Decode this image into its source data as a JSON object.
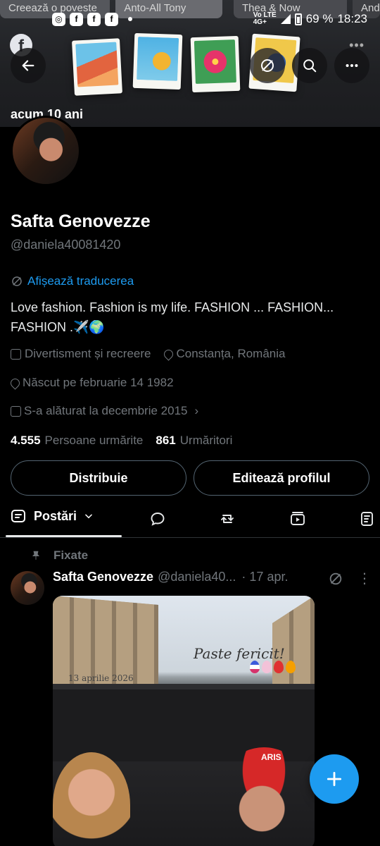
{
  "stories": [
    "Creează o poveste",
    "Anto-All Tony",
    "Thea & Now",
    "And"
  ],
  "status": {
    "net_top": "4G+",
    "net_left": "Vo LTE",
    "battery": "69 %",
    "time": "18:23"
  },
  "header": {
    "memory_label": "acum 10 ani"
  },
  "profile": {
    "name": "Safta Genovezze",
    "handle": "@daniela40081420",
    "translate_label": "Afișează traducerea",
    "bio": "Love fashion. Fashion is my life. FASHION ... FASHION... FASHION .✈️🌍",
    "category": "Divertisment și recreere",
    "location": "Constanța, România",
    "born": "Născut pe februarie 14 1982",
    "joined": "S-a alăturat la decembrie 2015",
    "following_count": "4.555",
    "following_label": "Persoane urmărite",
    "followers_count": "861",
    "followers_label": "Urmăritori"
  },
  "actions": {
    "share": "Distribuie",
    "edit": "Editează profilul"
  },
  "tabs": {
    "posts": "Postări"
  },
  "post": {
    "pinned_label": "Fixate",
    "name": "Safta Genovezze",
    "handle": "@daniela40...",
    "time": "· 17 apr.",
    "image_title": "Paste fericit!",
    "image_date": "13 aprilie 2026",
    "cap_text": "ARIS"
  },
  "colors": {
    "accent": "#1d9bf0",
    "muted": "#71767b",
    "bg": "#000000"
  }
}
